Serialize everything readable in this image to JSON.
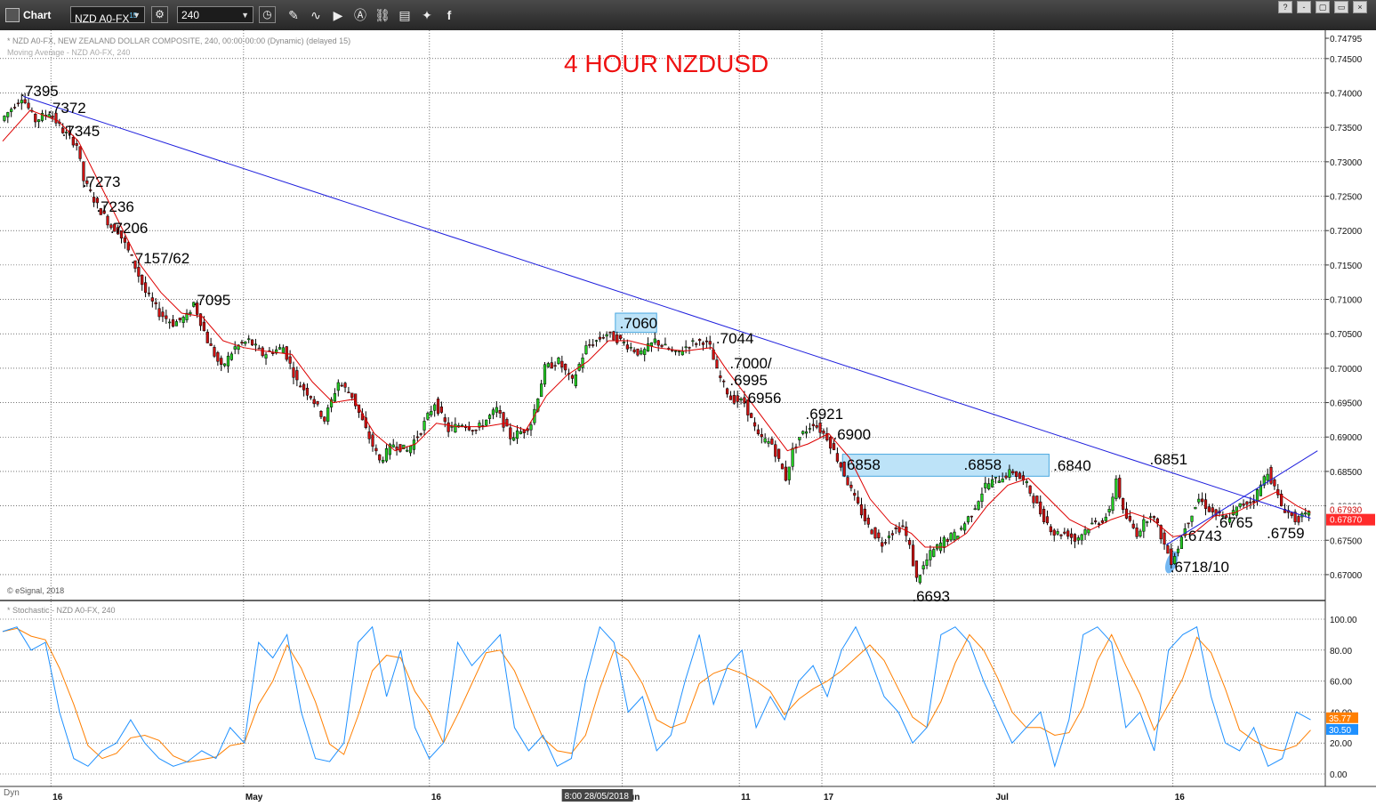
{
  "toolbar": {
    "title": "Chart",
    "symbol": "NZD A0-FX",
    "symbol_sup": "15",
    "interval": "240",
    "icons": [
      "gear-icon",
      "clock-icon",
      "draw-icon",
      "play-icon",
      "alert-icon",
      "link-icon",
      "comment-icon",
      "twitter-icon",
      "facebook-icon"
    ],
    "window_buttons": [
      "?",
      "-",
      "▢",
      "▭",
      "×"
    ]
  },
  "chart_header": {
    "line1": "* NZD A0-FX, NEW ZEALAND DOLLAR COMPOSITE, 240, 00:00-00:00 (Dynamic) (delayed 15)",
    "line2": "Moving Average - NZD A0-FX, 240",
    "copyright": "© eSignal, 2018",
    "stochastic_label": "* Stochastic - NZD A0-FX, 240",
    "dyn_label": "Dyn"
  },
  "colors": {
    "up_candle": "#22cc22",
    "down_candle": "#cc1111",
    "moving_average": "#dd0000",
    "trendline": "#1f1fdd",
    "stoch_k": "#1e90ff",
    "stoch_d": "#ff7f00",
    "highlight": "#bde3f8",
    "price_badge": "#ff2a2a",
    "title": "#ee1111"
  },
  "chart_data": {
    "type": "candlestick",
    "title": "4 HOUR NZDUSD",
    "instrument": "NZD A0-FX",
    "interval": "240",
    "y_price_ticks": [
      "0.74795",
      "0.74500",
      "0.74000",
      "0.73500",
      "0.73000",
      "0.72500",
      "0.72000",
      "0.71500",
      "0.71000",
      "0.70500",
      "0.70000",
      "0.69500",
      "0.69000",
      "0.68500",
      "0.68000",
      "0.67500",
      "0.67000"
    ],
    "y_range": [
      0.6665,
      0.7486
    ],
    "last_price": "0.67870",
    "last_price_behind": "0.67930",
    "x_tick_labels": [
      "16",
      "May",
      "16",
      "Jun",
      "11",
      "17",
      "Jul",
      "16"
    ],
    "crosshair_label": "8:00 28/05/2018",
    "price_path": [
      [
        0,
        0.736
      ],
      [
        3,
        0.7395
      ],
      [
        5,
        0.736
      ],
      [
        7,
        0.7372
      ],
      [
        9,
        0.7345
      ],
      [
        11,
        0.7325
      ],
      [
        12,
        0.7273
      ],
      [
        14,
        0.7236
      ],
      [
        16,
        0.7206
      ],
      [
        17,
        0.72
      ],
      [
        19,
        0.716
      ],
      [
        21,
        0.711
      ],
      [
        23,
        0.708
      ],
      [
        25,
        0.7065
      ],
      [
        27,
        0.7075
      ],
      [
        28,
        0.7095
      ],
      [
        30,
        0.704
      ],
      [
        32,
        0.7
      ],
      [
        34,
        0.703
      ],
      [
        36,
        0.704
      ],
      [
        38,
        0.702
      ],
      [
        41,
        0.703
      ],
      [
        43,
        0.698
      ],
      [
        45,
        0.696
      ],
      [
        47,
        0.6925
      ],
      [
        49,
        0.698
      ],
      [
        51,
        0.696
      ],
      [
        53,
        0.691
      ],
      [
        55,
        0.6865
      ],
      [
        57,
        0.689
      ],
      [
        59,
        0.688
      ],
      [
        61,
        0.691
      ],
      [
        63,
        0.695
      ],
      [
        65,
        0.691
      ],
      [
        67,
        0.692
      ],
      [
        69,
        0.691
      ],
      [
        72,
        0.694
      ],
      [
        74,
        0.69
      ],
      [
        76,
        0.691
      ],
      [
        77,
        0.692
      ],
      [
        79,
        0.7
      ],
      [
        81,
        0.701
      ],
      [
        83,
        0.698
      ],
      [
        85,
        0.703
      ],
      [
        88,
        0.705
      ],
      [
        90,
        0.704
      ],
      [
        93,
        0.702
      ],
      [
        95,
        0.704
      ],
      [
        98,
        0.702
      ],
      [
        100,
        0.7035
      ],
      [
        102,
        0.704
      ],
      [
        103,
        0.703
      ],
      [
        104,
        0.6995
      ],
      [
        106,
        0.6956
      ],
      [
        108,
        0.695
      ],
      [
        110,
        0.69
      ],
      [
        112,
        0.689
      ],
      [
        114,
        0.684
      ],
      [
        115,
        0.688
      ],
      [
        116,
        0.69
      ],
      [
        118,
        0.6921
      ],
      [
        119,
        0.691
      ],
      [
        120,
        0.69
      ],
      [
        122,
        0.6858
      ],
      [
        124,
        0.681
      ],
      [
        126,
        0.677
      ],
      [
        128,
        0.6745
      ],
      [
        129,
        0.676
      ],
      [
        131,
        0.677
      ],
      [
        132,
        0.674
      ],
      [
        133,
        0.6693
      ],
      [
        135,
        0.673
      ],
      [
        137,
        0.675
      ],
      [
        139,
        0.676
      ],
      [
        141,
        0.679
      ],
      [
        143,
        0.683
      ],
      [
        145,
        0.684
      ],
      [
        147,
        0.685
      ],
      [
        149,
        0.683
      ],
      [
        151,
        0.679
      ],
      [
        153,
        0.676
      ],
      [
        155,
        0.676
      ],
      [
        156,
        0.675
      ],
      [
        158,
        0.677
      ],
      [
        160,
        0.678
      ],
      [
        161,
        0.679
      ],
      [
        162,
        0.684
      ],
      [
        163,
        0.679
      ],
      [
        165,
        0.676
      ],
      [
        167,
        0.679
      ],
      [
        168,
        0.677
      ],
      [
        169,
        0.6743
      ],
      [
        170,
        0.672
      ],
      [
        171,
        0.674
      ],
      [
        172,
        0.677
      ],
      [
        174,
        0.681
      ],
      [
        176,
        0.679
      ],
      [
        178,
        0.678
      ],
      [
        180,
        0.68
      ],
      [
        182,
        0.681
      ],
      [
        183,
        0.683
      ],
      [
        184,
        0.6851
      ],
      [
        186,
        0.68
      ],
      [
        188,
        0.678
      ],
      [
        190,
        0.6787
      ]
    ],
    "moving_average_path": [
      [
        0,
        0.733
      ],
      [
        4,
        0.7375
      ],
      [
        8,
        0.736
      ],
      [
        11,
        0.733
      ],
      [
        14,
        0.727
      ],
      [
        17,
        0.721
      ],
      [
        20,
        0.715
      ],
      [
        23,
        0.711
      ],
      [
        26,
        0.708
      ],
      [
        29,
        0.7075
      ],
      [
        32,
        0.704
      ],
      [
        35,
        0.703
      ],
      [
        38,
        0.7025
      ],
      [
        42,
        0.702
      ],
      [
        45,
        0.698
      ],
      [
        48,
        0.695
      ],
      [
        51,
        0.6955
      ],
      [
        54,
        0.6905
      ],
      [
        57,
        0.688
      ],
      [
        60,
        0.689
      ],
      [
        63,
        0.692
      ],
      [
        66,
        0.6915
      ],
      [
        70,
        0.6915
      ],
      [
        73,
        0.692
      ],
      [
        76,
        0.691
      ],
      [
        79,
        0.696
      ],
      [
        82,
        0.699
      ],
      [
        85,
        0.701
      ],
      [
        88,
        0.704
      ],
      [
        91,
        0.704
      ],
      [
        95,
        0.703
      ],
      [
        99,
        0.7025
      ],
      [
        103,
        0.703
      ],
      [
        105,
        0.7
      ],
      [
        108,
        0.696
      ],
      [
        111,
        0.692
      ],
      [
        114,
        0.688
      ],
      [
        117,
        0.689
      ],
      [
        120,
        0.6905
      ],
      [
        123,
        0.687
      ],
      [
        126,
        0.681
      ],
      [
        129,
        0.6775
      ],
      [
        132,
        0.676
      ],
      [
        134,
        0.674
      ],
      [
        137,
        0.674
      ],
      [
        140,
        0.676
      ],
      [
        143,
        0.68
      ],
      [
        146,
        0.683
      ],
      [
        149,
        0.684
      ],
      [
        152,
        0.681
      ],
      [
        155,
        0.678
      ],
      [
        158,
        0.6765
      ],
      [
        161,
        0.678
      ],
      [
        164,
        0.679
      ],
      [
        167,
        0.678
      ],
      [
        170,
        0.6755
      ],
      [
        173,
        0.676
      ],
      [
        176,
        0.6785
      ],
      [
        179,
        0.679
      ],
      [
        182,
        0.6805
      ],
      [
        185,
        0.682
      ],
      [
        188,
        0.68
      ],
      [
        190,
        0.679
      ]
    ],
    "trendlines": [
      {
        "from": [
          3,
          0.7395
        ],
        "to": [
          190,
          0.6782
        ]
      },
      {
        "from": [
          169,
          0.6743
        ],
        "to": [
          191,
          0.688
        ]
      }
    ],
    "highlight_zones": [
      {
        "label": ".7060",
        "x_from": 89,
        "x_to": 95,
        "y_from": 0.7052,
        "y_to": 0.708
      },
      {
        "label": "6858",
        "x_from": 122,
        "x_to": 152,
        "y_from": 0.6843,
        "y_to": 0.6875
      }
    ],
    "annotations": [
      {
        "text": ".7395",
        "x": 3,
        "y": 0.7395
      },
      {
        "text": ".7372",
        "x": 7,
        "y": 0.7372
      },
      {
        "text": ".7345",
        "x": 9,
        "y": 0.7345
      },
      {
        "text": ".7273",
        "x": 12,
        "y": 0.7273
      },
      {
        "text": ".7236",
        "x": 14,
        "y": 0.7236
      },
      {
        "text": ".7206",
        "x": 16,
        "y": 0.7206
      },
      {
        "text": ".7157/62",
        "x": 19,
        "y": 0.7157
      },
      {
        "text": ".7095",
        "x": 28,
        "y": 0.7095
      },
      {
        "text": ".7060",
        "x": 90,
        "y": 0.706
      },
      {
        "text": ".7044",
        "x": 104,
        "y": 0.7044
      },
      {
        "text": ".7000/",
        "x": 106,
        "y": 0.701
      },
      {
        "text": ".6995",
        "x": 106,
        "y": 0.6985
      },
      {
        "text": ".6956",
        "x": 108,
        "y": 0.6956
      },
      {
        "text": ".6921",
        "x": 117,
        "y": 0.6921
      },
      {
        "text": ".6900",
        "x": 121,
        "y": 0.69
      },
      {
        "text": "6858",
        "x": 123,
        "y": 0.6858
      },
      {
        "text": ".6858",
        "x": 140,
        "y": 0.6858
      },
      {
        "text": ".6840",
        "x": 153,
        "y": 0.684
      },
      {
        "text": ".6851",
        "x": 167,
        "y": 0.6851
      },
      {
        "text": ".6765",
        "x": 176,
        "y": 0.6765
      },
      {
        "text": ".6743",
        "x": 172,
        "y": 0.6743
      },
      {
        "text": ".6759",
        "x": 184,
        "y": 0.6759
      },
      {
        "text": ".6718/10",
        "x": 170,
        "y": 0.6718
      },
      {
        "text": ".6693",
        "x": 133,
        "y": 0.6693
      }
    ],
    "stochastic": {
      "name": "Stochastic",
      "y_ticks": [
        "100.00",
        "80.00",
        "60.00",
        "40.00",
        "20.00",
        "0.00"
      ],
      "y_range": [
        0,
        100
      ],
      "k_value": "30.50",
      "d_value": "35.77",
      "k": [
        92,
        95,
        80,
        85,
        40,
        10,
        5,
        15,
        20,
        35,
        20,
        10,
        5,
        8,
        15,
        10,
        30,
        20,
        85,
        75,
        90,
        40,
        10,
        8,
        20,
        85,
        95,
        50,
        80,
        30,
        10,
        20,
        85,
        70,
        80,
        90,
        30,
        15,
        25,
        5,
        10,
        60,
        95,
        85,
        40,
        50,
        15,
        25,
        60,
        90,
        45,
        70,
        80,
        30,
        50,
        35,
        60,
        70,
        50,
        80,
        95,
        75,
        50,
        40,
        20,
        30,
        90,
        95,
        85,
        60,
        40,
        20,
        30,
        40,
        5,
        35,
        90,
        95,
        85,
        30,
        40,
        15,
        80,
        90,
        95,
        50,
        20,
        15,
        30,
        5,
        10,
        40,
        35
      ]
    }
  }
}
